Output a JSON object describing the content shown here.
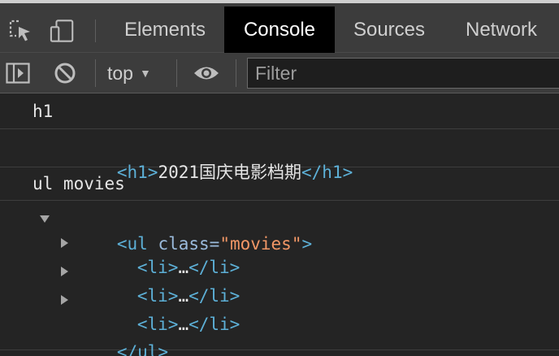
{
  "tabs": [
    {
      "label": "Elements",
      "active": false
    },
    {
      "label": "Console",
      "active": true
    },
    {
      "label": "Sources",
      "active": false
    },
    {
      "label": "Network",
      "active": false
    }
  ],
  "toolbar": {
    "context_label": "top",
    "filter_placeholder": "Filter"
  },
  "console": {
    "log1_label": "h1",
    "h1_open": "<h1>",
    "h1_text": "2021国庆电影档期",
    "h1_close": "</h1>",
    "log2_label": "ul movies",
    "ul_open": "<ul",
    "ul_attr_name": " class=",
    "ul_attr_value": "\"movies\"",
    "ul_open_end": ">",
    "li_items": [
      {
        "open": "<li>",
        "ellipsis": "…",
        "close": "</li>"
      },
      {
        "open": "<li>",
        "ellipsis": "…",
        "close": "</li>"
      },
      {
        "open": "<li>",
        "ellipsis": "…",
        "close": "</li>"
      }
    ],
    "ul_close": "</ul>"
  },
  "icons": {
    "inspect": "inspect-element-icon",
    "device": "device-toolbar-icon",
    "sidebar": "show-console-sidebar-icon",
    "clear": "clear-console-icon",
    "eye": "live-expression-eye-icon"
  },
  "colors": {
    "background": "#242424",
    "toolbar": "#3c3c3c",
    "tag": "#5db0d7",
    "attr_value": "#f29766",
    "active_tab": "#000000"
  }
}
